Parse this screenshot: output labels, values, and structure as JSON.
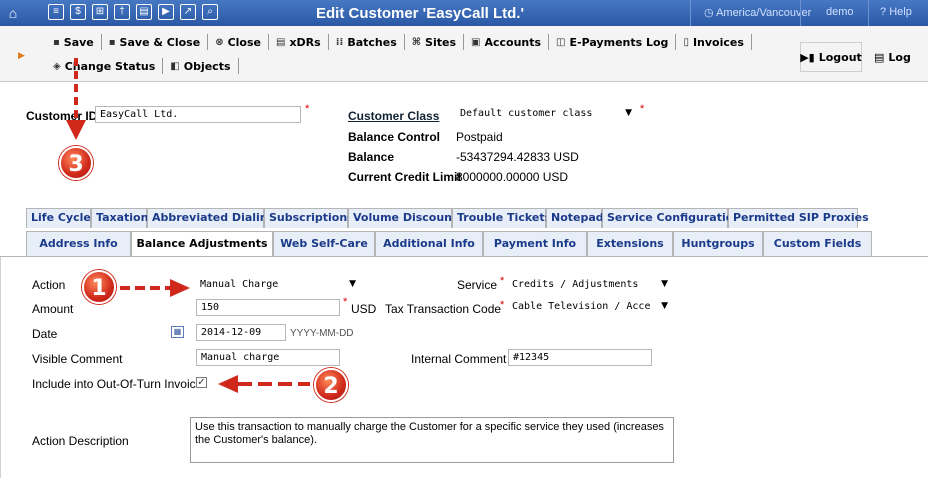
{
  "header": {
    "title": "Edit Customer 'EasyCall Ltd.'",
    "timezone": "America/Vancouver",
    "user": "demo",
    "help": "Help"
  },
  "toolbar": {
    "row1": [
      {
        "label": "Save",
        "icon": "floppy-icon"
      },
      {
        "label": "Save & Close",
        "icon": "floppy-icon"
      },
      {
        "label": "Close",
        "icon": "close-circle-icon"
      },
      {
        "label": "xDRs",
        "icon": "list-icon"
      },
      {
        "label": "Batches",
        "icon": "batches-icon"
      },
      {
        "label": "Sites",
        "icon": "sites-icon"
      },
      {
        "label": "Accounts",
        "icon": "accounts-icon"
      },
      {
        "label": "E-Payments Log",
        "icon": "payment-icon"
      },
      {
        "label": "Invoices",
        "icon": "invoice-icon"
      }
    ],
    "row2": [
      {
        "label": "Change Status",
        "icon": "status-icon"
      },
      {
        "label": "Objects",
        "icon": "objects-icon"
      }
    ],
    "logout": "Logout",
    "log": "Log"
  },
  "customer": {
    "id_label": "Customer ID",
    "id_value": "EasyCall Ltd.",
    "class_label": "Customer Class",
    "class_value": "Default customer class",
    "balance_control_label": "Balance Control",
    "balance_control_value": "Postpaid",
    "balance_label": "Balance",
    "balance_value": "-53437294.42833 USD",
    "credit_label": "Current Credit Limit",
    "credit_value": "8000000.00000 USD"
  },
  "tabs_row1": [
    "Life Cycle",
    "Taxation",
    "Abbreviated Dialing",
    "Subscriptions",
    "Volume Discounts",
    "Trouble Tickets",
    "Notepad",
    "Service Configuration",
    "Permitted SIP Proxies"
  ],
  "tabs_row2": [
    "Address Info",
    "Balance Adjustments",
    "Web Self-Care",
    "Additional Info",
    "Payment Info",
    "Extensions",
    "Huntgroups",
    "Custom Fields"
  ],
  "active_tab": "Balance Adjustments",
  "form": {
    "action_label": "Action",
    "action_value": "Manual Charge",
    "amount_label": "Amount",
    "amount_value": "150",
    "currency": "USD",
    "date_label": "Date",
    "date_value": "2014-12-09",
    "date_format": "YYYY-MM-DD",
    "visible_comment_label": "Visible Comment",
    "visible_comment_value": "Manual charge",
    "include_label": "Include into Out-Of-Turn Invoice",
    "include_checked": true,
    "service_label": "Service",
    "service_value": "Credits / Adjustments",
    "tax_label": "Tax Transaction Code",
    "tax_value": "Cable Television / Acce",
    "internal_comment_label": "Internal Comment",
    "internal_comment_value": "#12345",
    "description_label": "Action Description",
    "description_value": "Use this transaction to manually charge the Customer for a specific service they used (increases the Customer's balance)."
  },
  "annotations": [
    "1",
    "2",
    "3"
  ],
  "colors": {
    "header": "#2e5eae",
    "accent": "#d0281a",
    "tab_text": "#1a3a8a"
  }
}
